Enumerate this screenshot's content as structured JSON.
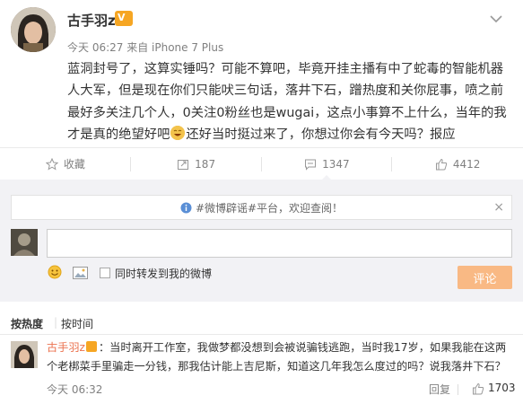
{
  "post": {
    "username": "古手羽z",
    "vip_badge": "V",
    "meta": "今天 06:27 来自 iPhone 7 Plus",
    "text_parts": [
      "蓝洞封号了，这算实锤吗？可能不算吧，毕竟开挂主播有中了蛇毒的智能机器人大军，但是现在你们只能吠三句话，落井下石，蹭热度和关你屁事，喷之前最好多关注几个人，0关注0粉丝也是wugai，这点小事算不上什么，当年的我才是真的绝望好吧",
      "还好当时挺过来了，你想过你会有今天吗？报应"
    ]
  },
  "actions": {
    "favorite_label": "收藏",
    "repost_count": "187",
    "comment_count": "1347",
    "like_count": "4412"
  },
  "comment_box": {
    "notice": "#微博辟谣#平台，欢迎查阅！",
    "close": "×",
    "repost_label": "同时转发到我的微博",
    "submit_label": "评论"
  },
  "sort": {
    "hot": "按热度",
    "divider": "|",
    "time": "按时间"
  },
  "comment": {
    "user": "古手羽z",
    "text": "：当时离开工作室，我做梦都没想到会被说骗钱逃跑，当时我17岁，如果我能在这两个老梆菜手里骗走一分钱，那我估计能上吉尼斯，知道这几年我怎么度过的吗？说我落井下石？",
    "time": "今天 06:32",
    "reply_label": "回复",
    "like_count": "1703"
  },
  "colors": {
    "accent_orange": "#eb7350",
    "vip_gold": "#f6a623",
    "panel_bg": "#f2f2f5",
    "submit_disabled": "#f9b984"
  },
  "icons": [
    "chevron-down-icon",
    "star-icon",
    "repost-icon",
    "comment-icon",
    "thumbs-up-icon",
    "info-icon",
    "smiley-icon",
    "image-icon",
    "close-icon",
    "laugh-emoji-icon"
  ]
}
